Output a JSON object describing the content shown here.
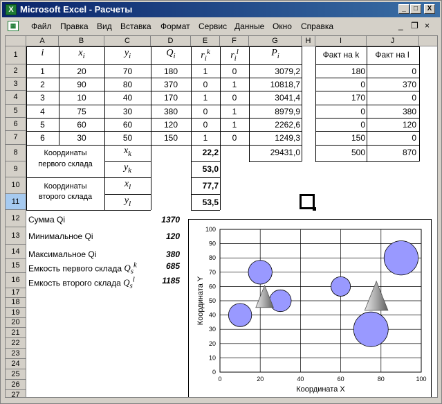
{
  "window": {
    "title": "Microsoft Excel - Расчеты",
    "btn_min": "_",
    "btn_max": "□",
    "btn_close": "X"
  },
  "menu": {
    "items": [
      "Файл",
      "Правка",
      "Вид",
      "Вставка",
      "Формат",
      "Сервис",
      "Данные",
      "Окно",
      "Справка"
    ],
    "ctl_min": "_",
    "ctl_restore": "❐",
    "ctl_close": "×"
  },
  "columns": [
    "A",
    "B",
    "C",
    "D",
    "E",
    "F",
    "G",
    "H",
    "I",
    "J"
  ],
  "rows": [
    "1",
    "2",
    "3",
    "4",
    "5",
    "6",
    "7",
    "8",
    "9",
    "10",
    "11",
    "12",
    "13",
    "14",
    "15",
    "16",
    "17",
    "18",
    "19",
    "20",
    "21",
    "22",
    "23",
    "24",
    "25",
    "26",
    "27"
  ],
  "header_row": {
    "i": "i",
    "x": "x",
    "x_sub": "i",
    "y": "y",
    "y_sub": "i",
    "Q": "Q",
    "Q_sub": "i",
    "rk": "r",
    "rk_sub": "i",
    "rk_sup": "k",
    "rl": "r",
    "rl_sub": "i",
    "rl_sup": "l",
    "P": "P",
    "P_sub": "i",
    "fact_k": "Факт на k",
    "fact_l": "Факт на l"
  },
  "table": [
    [
      "1",
      "20",
      "70",
      "180",
      "1",
      "0",
      "3079,2",
      "180",
      "0"
    ],
    [
      "2",
      "90",
      "80",
      "370",
      "0",
      "1",
      "10818,7",
      "0",
      "370"
    ],
    [
      "3",
      "10",
      "40",
      "170",
      "1",
      "0",
      "3041,4",
      "170",
      "0"
    ],
    [
      "4",
      "75",
      "30",
      "380",
      "0",
      "1",
      "8979,9",
      "0",
      "380"
    ],
    [
      "5",
      "60",
      "60",
      "120",
      "0",
      "1",
      "2262,6",
      "0",
      "120"
    ],
    [
      "6",
      "30",
      "50",
      "150",
      "1",
      "0",
      "1249,3",
      "150",
      "0"
    ]
  ],
  "totals": {
    "p_sum": "29431,0",
    "fact_k_sum": "500",
    "fact_l_sum": "870"
  },
  "coords": {
    "first_label_1": "Координаты",
    "first_label_2": "первого склада",
    "second_label_1": "Координаты",
    "second_label_2": "второго склада",
    "xk": "x",
    "xk_sub": "k",
    "yk": "y",
    "yk_sub": "k",
    "xl": "x",
    "xl_sub": "l",
    "yl": "y",
    "yl_sub": "l",
    "xk_val": "22,2",
    "yk_val": "53,0",
    "xl_val": "77,7",
    "yl_val": "53,5"
  },
  "summary": {
    "sum_label": "Сумма Qi",
    "sum_val": "1370",
    "min_label": "Минимальное  Qi",
    "min_val": "120",
    "max_label": "Максимальное Qi",
    "max_val": "380",
    "cap1_label": "Емкость первого склада",
    "cap1_sym": "Q",
    "cap1_sub": "s",
    "cap1_sup": "k",
    "cap1_val": "685",
    "cap2_label": "Емкость второго склада",
    "cap2_sym": "Q",
    "cap2_sub": "s",
    "cap2_sup": "l",
    "cap2_val": "1185"
  },
  "chart_data": {
    "type": "scatter",
    "xlabel": "Координата X",
    "ylabel": "Координата Y",
    "xlim": [
      0,
      100
    ],
    "ylim": [
      0,
      100
    ],
    "xticks": [
      0,
      20,
      40,
      60,
      80,
      100
    ],
    "yticks": [
      0,
      10,
      20,
      30,
      40,
      50,
      60,
      70,
      80,
      90,
      100
    ],
    "grid": true,
    "series": [
      {
        "marker": "circle",
        "color": "#9999ff",
        "points": [
          {
            "x": 20,
            "y": 70,
            "size": 180
          },
          {
            "x": 90,
            "y": 80,
            "size": 370
          },
          {
            "x": 10,
            "y": 40,
            "size": 170
          },
          {
            "x": 75,
            "y": 30,
            "size": 380
          },
          {
            "x": 60,
            "y": 60,
            "size": 120
          },
          {
            "x": 30,
            "y": 50,
            "size": 150
          }
        ]
      },
      {
        "marker": "triangle",
        "color": "#a0a0a0",
        "points": [
          {
            "x": 22.2,
            "y": 53.0,
            "size": 685
          },
          {
            "x": 77.7,
            "y": 53.5,
            "size": 1185
          }
        ]
      }
    ]
  }
}
